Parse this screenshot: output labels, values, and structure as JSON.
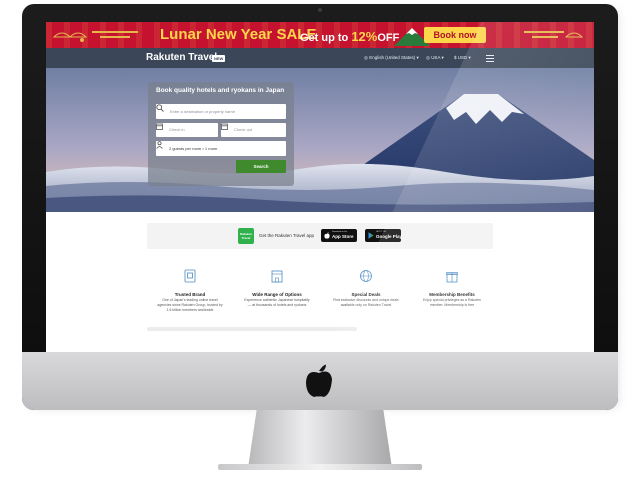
{
  "promo": {
    "title": "Lunar New Year SALE",
    "subtitle_prefix": "Get up to ",
    "subtitle_percent": "12%",
    "subtitle_suffix": "OFF",
    "cta": "Book now"
  },
  "nav": {
    "brand_name": "Rakuten Travel",
    "brand_badge": "NEW",
    "language": "English (United States)",
    "region": "USA",
    "currency": "USD"
  },
  "search": {
    "title": "Book quality hotels and ryokans in Japan",
    "destination_placeholder": "Enter a destination or property name",
    "checkin_placeholder": "Check in",
    "checkout_placeholder": "Check out",
    "guests_value": "2 guests per room • 1 room",
    "button": "Search"
  },
  "app_promo": {
    "logo_text_1": "Rakuten",
    "logo_text_2": "Travel",
    "text": "Get the Rakuten Travel app",
    "apple_small": "Download on the",
    "apple_big": "App Store",
    "google_small": "GET IT ON",
    "google_big": "Google Play"
  },
  "features": [
    {
      "icon": "shield-icon",
      "title": "Trusted Brand",
      "desc": "One of Japan's leading online travel agencies since Rakuten Group, trusted by 1.6 billion members worldwide"
    },
    {
      "icon": "building-icon",
      "title": "Wide Range of Options",
      "desc": "Experience authentic Japanese hospitality — at thousands of hotels and ryokans"
    },
    {
      "icon": "globe-icon",
      "title": "Special Deals",
      "desc": "Find exclusive discounts and unique deals available only on Rakuten Travel"
    },
    {
      "icon": "gift-icon",
      "title": "Membership Benefits",
      "desc": "Enjoy special privileges as a Rakuten member. Membership is free"
    }
  ],
  "colors": {
    "banner_red": "#c4122f",
    "banner_gold": "#ffd54a",
    "nav_bg": "#3b4759",
    "search_green": "#3e8a2c",
    "app_green": "#2fb24c"
  }
}
